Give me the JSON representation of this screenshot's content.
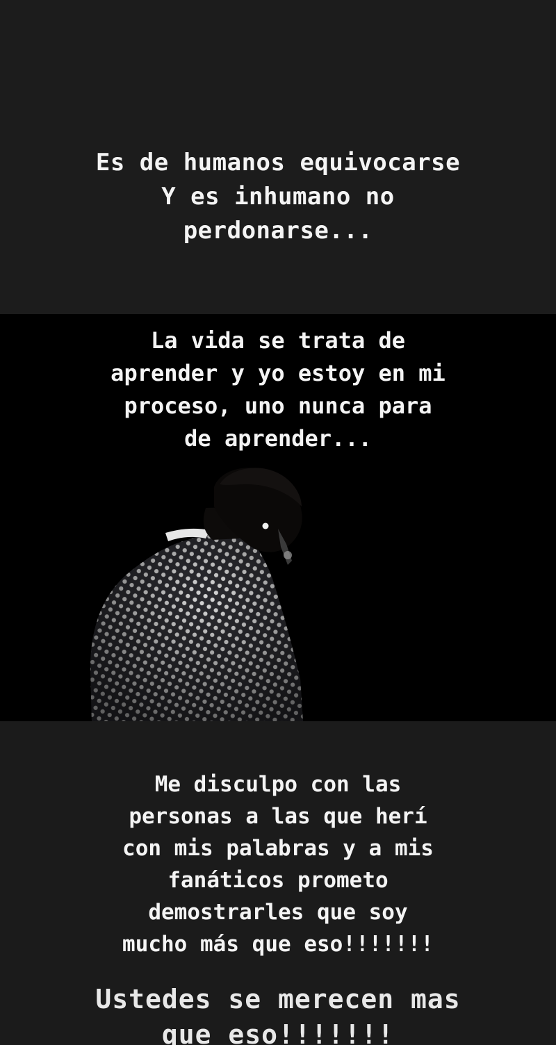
{
  "story": {
    "top_text": "Es de humanos equivocarse\nY es inhumano no\nperdonarse...",
    "middle_text": "La vida se trata de\naprender y yo estoy en mi\nproceso, uno nunca para\nde aprender...",
    "bottom_text": "Me disculpo con las\npersonas a las que herí\ncon mis palabras y a mis\nfanáticos prometo\ndemostrarles que soy\nmucho más que eso!!!!!!!",
    "closing_text": "Ustedes se merecen mas\nque eso!!!!!!!"
  },
  "colors": {
    "top_panel": "#1c1c1c",
    "photo_panel": "#000000",
    "bottom_panel": "#1b1b1b",
    "text": "#f4f4f4",
    "jacket": "#2b2b30",
    "jacket_dots": "#d8d8d8"
  }
}
